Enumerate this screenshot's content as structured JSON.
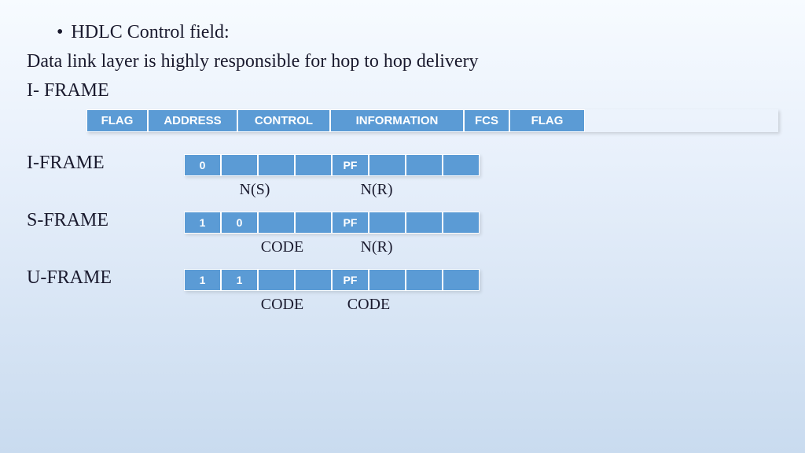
{
  "title": "HDLC Control field:",
  "subtitle": "Data link layer is highly responsible for hop to hop delivery",
  "frame_heading": "I- FRAME",
  "header": {
    "flag": "FLAG",
    "address": "ADDRESS",
    "control": "CONTROL",
    "information": "INFORMATION",
    "fcs": "FCS",
    "flag2": "FLAG"
  },
  "iframe": {
    "label": "I-FRAME",
    "bits": [
      "0",
      "",
      "",
      "",
      "PF",
      "",
      "",
      ""
    ],
    "sub1": "N(S)",
    "sub2": "N(R)"
  },
  "sframe": {
    "label": "S-FRAME",
    "bits": [
      "1",
      "0",
      "",
      "",
      "PF",
      "",
      "",
      ""
    ],
    "sub1": "CODE",
    "sub2": "N(R)"
  },
  "uframe": {
    "label": "U-FRAME",
    "bits": [
      "1",
      "1",
      "",
      "",
      "PF",
      "",
      "",
      ""
    ],
    "sub1": "CODE",
    "sub2": "CODE"
  }
}
